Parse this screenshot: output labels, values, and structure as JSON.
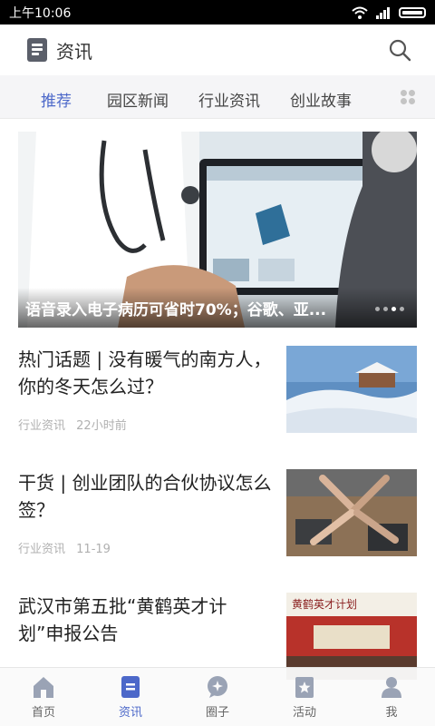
{
  "status_bar": {
    "time": "上午10:06"
  },
  "header": {
    "title": "资讯",
    "icon": "document-icon",
    "search_icon": "search-icon"
  },
  "tabs": [
    {
      "label": "推荐",
      "active": true
    },
    {
      "label": "园区新闻",
      "active": false
    },
    {
      "label": "行业资讯",
      "active": false
    },
    {
      "label": "创业故事",
      "active": false
    }
  ],
  "banner": {
    "title": "语音录入电子病历可省时70%；谷歌、亚...",
    "slide_count": 4,
    "current_slide": 3
  },
  "articles": [
    {
      "title": "热门话题 | 没有暖气的南方人，你的冬天怎么过？",
      "category": "行业资讯",
      "time": "22小时前"
    },
    {
      "title": "干货 | 创业团队的合伙协议怎么签？",
      "category": "行业资讯",
      "time": "11-19"
    },
    {
      "title": "武汉市第五批“黄鹤英才计划”申报公告",
      "thumb_caption": "黄鹤英才计划"
    }
  ],
  "bottom_nav": [
    {
      "label": "首页",
      "icon": "home-icon",
      "active": false
    },
    {
      "label": "资讯",
      "icon": "news-icon",
      "active": true
    },
    {
      "label": "圈子",
      "icon": "circle-icon",
      "active": false
    },
    {
      "label": "活动",
      "icon": "activity-icon",
      "active": false
    },
    {
      "label": "我",
      "icon": "profile-icon",
      "active": false
    }
  ],
  "colors": {
    "accent": "#4c68c9",
    "nav_inactive": "#9aa3b5"
  }
}
